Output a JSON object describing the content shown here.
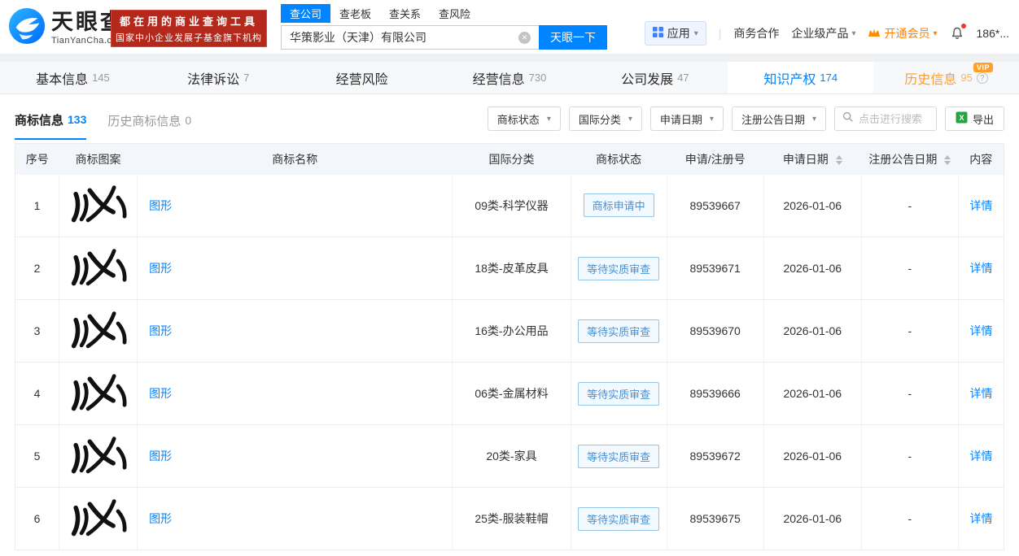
{
  "colors": {
    "brand_blue": "#0084ff",
    "promo_red": "#b5291d",
    "vip_orange": "#ff8000",
    "history_orange": "#ff9b2f",
    "status_blue": "#4a90d2",
    "link_blue": "#0084ff"
  },
  "icons": {
    "caret_down": "▾",
    "clear": "✕",
    "question": "?",
    "divider": "|"
  },
  "header": {
    "logo": {
      "cn": "天眼查",
      "en": "TianYanCha.com"
    },
    "promo": {
      "line1": "都在用的商业查询工具",
      "line2": "国家中小企业发展子基金旗下机构"
    },
    "search_tabs": [
      {
        "label": "查公司"
      },
      {
        "label": "查老板"
      },
      {
        "label": "查关系"
      },
      {
        "label": "查风险"
      }
    ],
    "search": {
      "value": "华策影业（天津）有限公司",
      "button": "天眼一下"
    },
    "right": {
      "apps": "应用",
      "biz": "商务合作",
      "enterprise": "企业级产品",
      "vip": "开通会员",
      "user": "186*..."
    }
  },
  "nav": {
    "tabs": [
      {
        "label": "基本信息",
        "count": "145"
      },
      {
        "label": "法律诉讼",
        "count": "7"
      },
      {
        "label": "经营风险",
        "count": ""
      },
      {
        "label": "经营信息",
        "count": "730"
      },
      {
        "label": "公司发展",
        "count": "47"
      },
      {
        "label": "知识产权",
        "count": "174"
      },
      {
        "label": "历史信息",
        "count": "95"
      }
    ],
    "vip_badge": "VIP"
  },
  "section": {
    "tabs": [
      {
        "label": "商标信息",
        "count": "133"
      },
      {
        "label": "历史商标信息",
        "count": "0"
      }
    ],
    "filters": [
      {
        "label": "商标状态"
      },
      {
        "label": "国际分类"
      },
      {
        "label": "申请日期"
      },
      {
        "label": "注册公告日期"
      }
    ],
    "search_placeholder": "点击进行搜索",
    "export_label": "导出"
  },
  "table": {
    "headers": [
      "序号",
      "商标图案",
      "商标名称",
      "国际分类",
      "商标状态",
      "申请/注册号",
      "申请日期",
      "注册公告日期",
      "内容"
    ],
    "rows": [
      {
        "no": "1",
        "name": "图形",
        "class": "09类-科学仪器",
        "status": "商标申请中",
        "reg_no": "89539667",
        "apply_date": "2026-01-06",
        "pub_date": "-",
        "detail": "详情"
      },
      {
        "no": "2",
        "name": "图形",
        "class": "18类-皮革皮具",
        "status": "等待实质审查",
        "reg_no": "89539671",
        "apply_date": "2026-01-06",
        "pub_date": "-",
        "detail": "详情"
      },
      {
        "no": "3",
        "name": "图形",
        "class": "16类-办公用品",
        "status": "等待实质审查",
        "reg_no": "89539670",
        "apply_date": "2026-01-06",
        "pub_date": "-",
        "detail": "详情"
      },
      {
        "no": "4",
        "name": "图形",
        "class": "06类-金属材料",
        "status": "等待实质审查",
        "reg_no": "89539666",
        "apply_date": "2026-01-06",
        "pub_date": "-",
        "detail": "详情"
      },
      {
        "no": "5",
        "name": "图形",
        "class": "20类-家具",
        "status": "等待实质审查",
        "reg_no": "89539672",
        "apply_date": "2026-01-06",
        "pub_date": "-",
        "detail": "详情"
      },
      {
        "no": "6",
        "name": "图形",
        "class": "25类-服装鞋帽",
        "status": "等待实质审查",
        "reg_no": "89539675",
        "apply_date": "2026-01-06",
        "pub_date": "-",
        "detail": "详情"
      }
    ]
  }
}
